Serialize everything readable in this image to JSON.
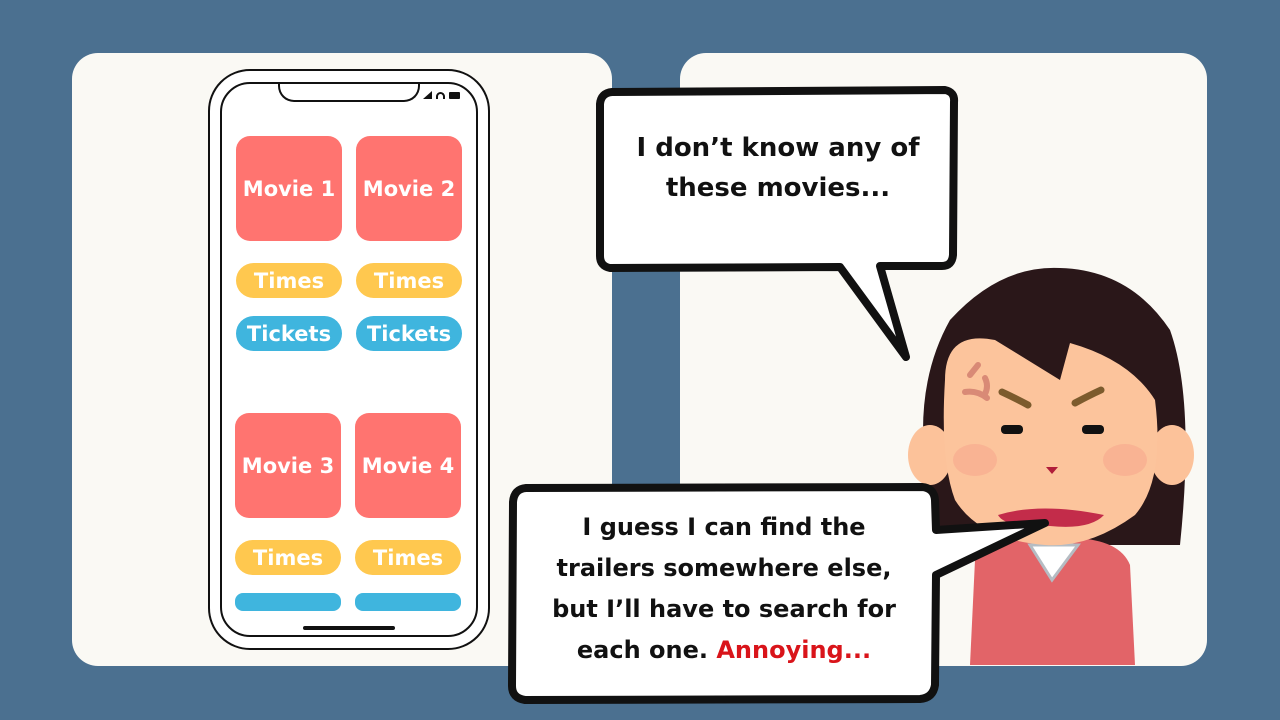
{
  "phone": {
    "movies": [
      {
        "title": "Movie 1",
        "times": "Times",
        "tickets": "Tickets"
      },
      {
        "title": "Movie 2",
        "times": "Times",
        "tickets": "Tickets"
      },
      {
        "title": "Movie 3",
        "times": "Times",
        "tickets": ""
      },
      {
        "title": "Movie 4",
        "times": "Times",
        "tickets": ""
      }
    ],
    "status_icons": [
      "signal-icon",
      "wifi-icon",
      "battery-icon"
    ]
  },
  "bubble1": {
    "line1": "I don’t know any of",
    "line2": "these movies..."
  },
  "bubble2": {
    "line1": "I guess I can find the",
    "line2": "trailers somewhere else,",
    "line3": "but I’ll have to search for",
    "line4": "each one.",
    "emphasis": "Annoying..."
  },
  "colors": {
    "background": "#4b7090",
    "panel": "#faf9f4",
    "movie": "#ff7470",
    "times": "#ffc84f",
    "tickets": "#3fb5de",
    "emphasis": "#d9141a"
  }
}
